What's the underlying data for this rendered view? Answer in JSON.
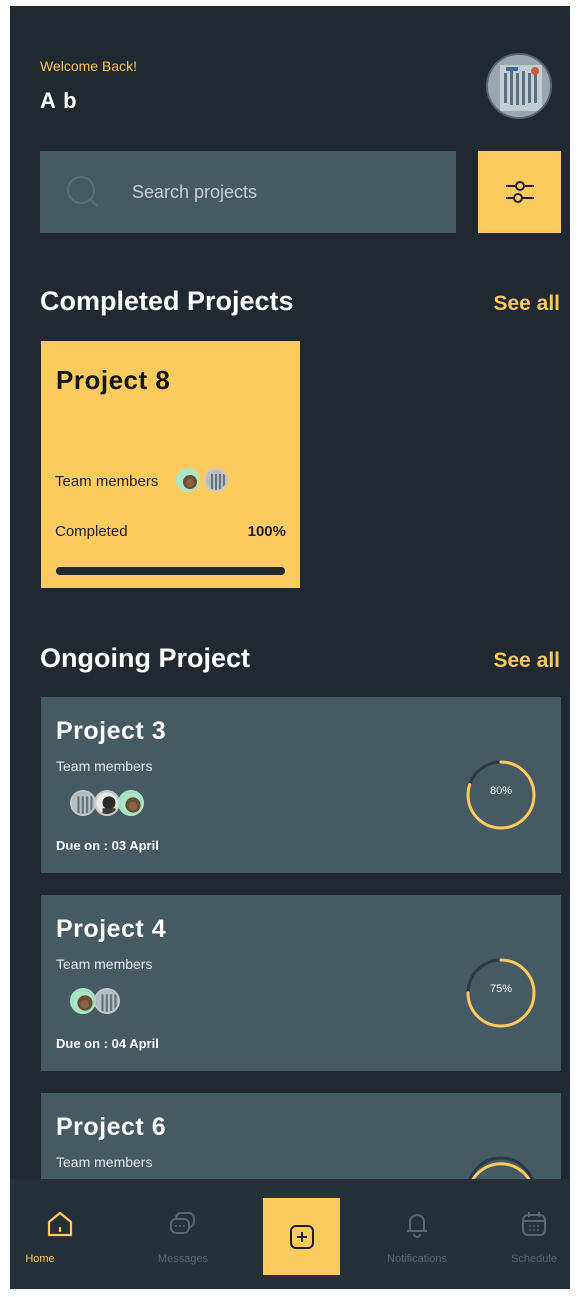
{
  "header": {
    "welcome": "Welcome Back!",
    "username": "A b"
  },
  "search": {
    "placeholder": "Search projects"
  },
  "completed": {
    "section_title": "Completed Projects",
    "see_all": "See all",
    "cards": [
      {
        "title": "Project 8",
        "team_label": "Team members",
        "status": "Completed",
        "progress_label": "100%",
        "progress": 100
      }
    ]
  },
  "ongoing": {
    "section_title": "Ongoing Project",
    "see_all": "See all",
    "cards": [
      {
        "title": "Project 3",
        "team_label": "Team members",
        "due_prefix": "Due on :",
        "due": "03 April",
        "progress_label": "80%",
        "progress": 80
      },
      {
        "title": "Project 4",
        "team_label": "Team members",
        "due_prefix": "Due on :",
        "due": "04 April",
        "progress_label": "75%",
        "progress": 75
      },
      {
        "title": "Project 6",
        "team_label": "Team members"
      }
    ]
  },
  "nav": {
    "items": [
      {
        "label": "Home",
        "icon": "home-icon"
      },
      {
        "label": "Messages",
        "icon": "messages-icon"
      },
      {
        "label": "",
        "icon": "add-icon"
      },
      {
        "label": "Notifications",
        "icon": "bell-icon"
      },
      {
        "label": "Schedule",
        "icon": "calendar-icon"
      }
    ]
  },
  "colors": {
    "background": "#212830",
    "card": "#455a62",
    "accent": "#fdca5e",
    "text_accent": "#f8c85c"
  }
}
